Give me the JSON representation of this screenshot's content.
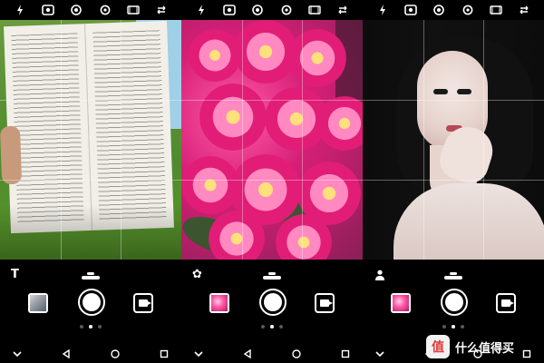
{
  "panels": [
    {
      "id": "panel-1",
      "mode_icon": "text-T-icon",
      "mode_label": "T",
      "scene": "book",
      "topbar_icons": [
        "flash-icon",
        "hdr-icon",
        "live-photo-icon",
        "settings-icon",
        "film-icon",
        "switch-camera-icon"
      ],
      "page_dots": {
        "count": 3,
        "active_index": 1
      },
      "gallery_thumb_style": "document"
    },
    {
      "id": "panel-2",
      "mode_icon": "flower-icon",
      "mode_label": "✿",
      "scene": "flowers",
      "topbar_icons": [
        "flash-icon",
        "hdr-icon",
        "live-photo-icon",
        "settings-icon",
        "film-icon",
        "switch-camera-icon"
      ],
      "page_dots": {
        "count": 3,
        "active_index": 1
      },
      "gallery_thumb_style": "flowers"
    },
    {
      "id": "panel-3",
      "mode_icon": "portrait-person-icon",
      "mode_label": "👤",
      "scene": "portrait",
      "topbar_icons": [
        "flash-icon",
        "hdr-icon",
        "live-photo-icon",
        "settings-icon",
        "film-icon",
        "switch-camera-icon"
      ],
      "page_dots": {
        "count": 3,
        "active_index": 1
      },
      "gallery_thumb_style": "flowers"
    }
  ],
  "watermark": {
    "logo": "值",
    "text": "什么值得买"
  },
  "colors": {
    "background": "#000000",
    "ui_white": "#ffffff",
    "flower_pink": "#e11d77",
    "grass_green": "#4f8a2e"
  }
}
